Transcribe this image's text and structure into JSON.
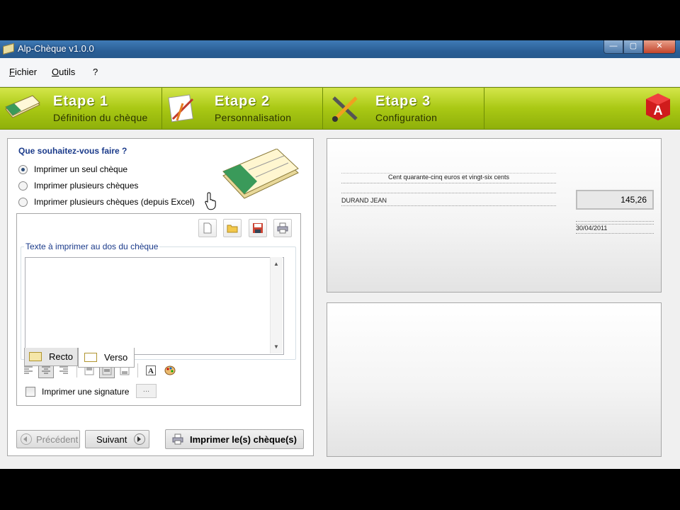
{
  "window": {
    "title": "Alp-Chèque v1.0.0",
    "minimize": "—",
    "maximize": "▢",
    "close": "✕"
  },
  "menu": [
    "Fichier",
    "Outils",
    "?"
  ],
  "steps": [
    {
      "title": "Etape 1",
      "subtitle": "Définition du chèque"
    },
    {
      "title": "Etape 2",
      "subtitle": "Personnalisation"
    },
    {
      "title": "Etape 3",
      "subtitle": "Configuration"
    }
  ],
  "options": {
    "question": "Que souhaitez-vous faire ?",
    "choices": [
      {
        "label": "Imprimer un seul chèque",
        "selected": true
      },
      {
        "label": "Imprimer plusieurs chèques",
        "selected": false
      },
      {
        "label": "Imprimer plusieurs chèques (depuis Excel)",
        "selected": false
      }
    ]
  },
  "verso": {
    "group_label": "Texte à imprimer au dos du chèque",
    "text": "",
    "signature_label": "Imprimer une signature",
    "signature_checked": false,
    "browse_label": "..."
  },
  "tabs": {
    "recto": "Recto",
    "verso": "Verso",
    "active": "verso"
  },
  "buttons": {
    "previous": "Précédent",
    "next": "Suivant",
    "print": "Imprimer le(s) chèque(s)"
  },
  "cheque": {
    "amount_words": "Cent quarante-cinq  euros  et vingt-six cents",
    "payee": "DURAND JEAN",
    "amount": "145,26",
    "date": "30/04/2011"
  },
  "colors": {
    "accent": "#a9c814",
    "title_bar": "#2b5f97",
    "label_blue": "#1a3a8a"
  }
}
